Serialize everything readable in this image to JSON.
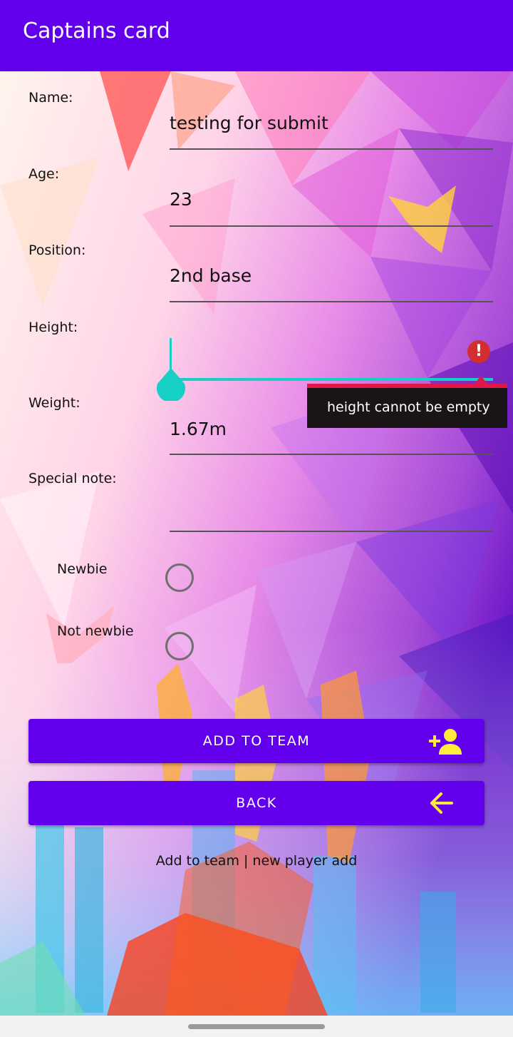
{
  "appbar": {
    "title": "Captains card"
  },
  "form": {
    "name_label": "Name:",
    "name_value": "testing for submit",
    "age_label": "Age:",
    "age_value": "23",
    "position_label": "Position:",
    "position_value": "2nd base",
    "height_label": "Height:",
    "height_value": "",
    "height_error": "height cannot be empty",
    "weight_label": "Weight:",
    "weight_value": "1.67m",
    "note_label": "Special note:",
    "note_value": ""
  },
  "radios": {
    "newbie_label": "Newbie",
    "not_newbie_label": "Not newbie"
  },
  "buttons": {
    "add_label": "ADD TO TEAM",
    "add_icon": "person-add-icon",
    "back_label": "BACK",
    "back_icon": "arrow-back-icon"
  },
  "footer": {
    "text": "Add to team | new player add"
  },
  "colors": {
    "primary": "#6200ee",
    "icon_accent": "#ffeb3b",
    "slider": "#16d0c6",
    "error": "#d32f2f"
  }
}
